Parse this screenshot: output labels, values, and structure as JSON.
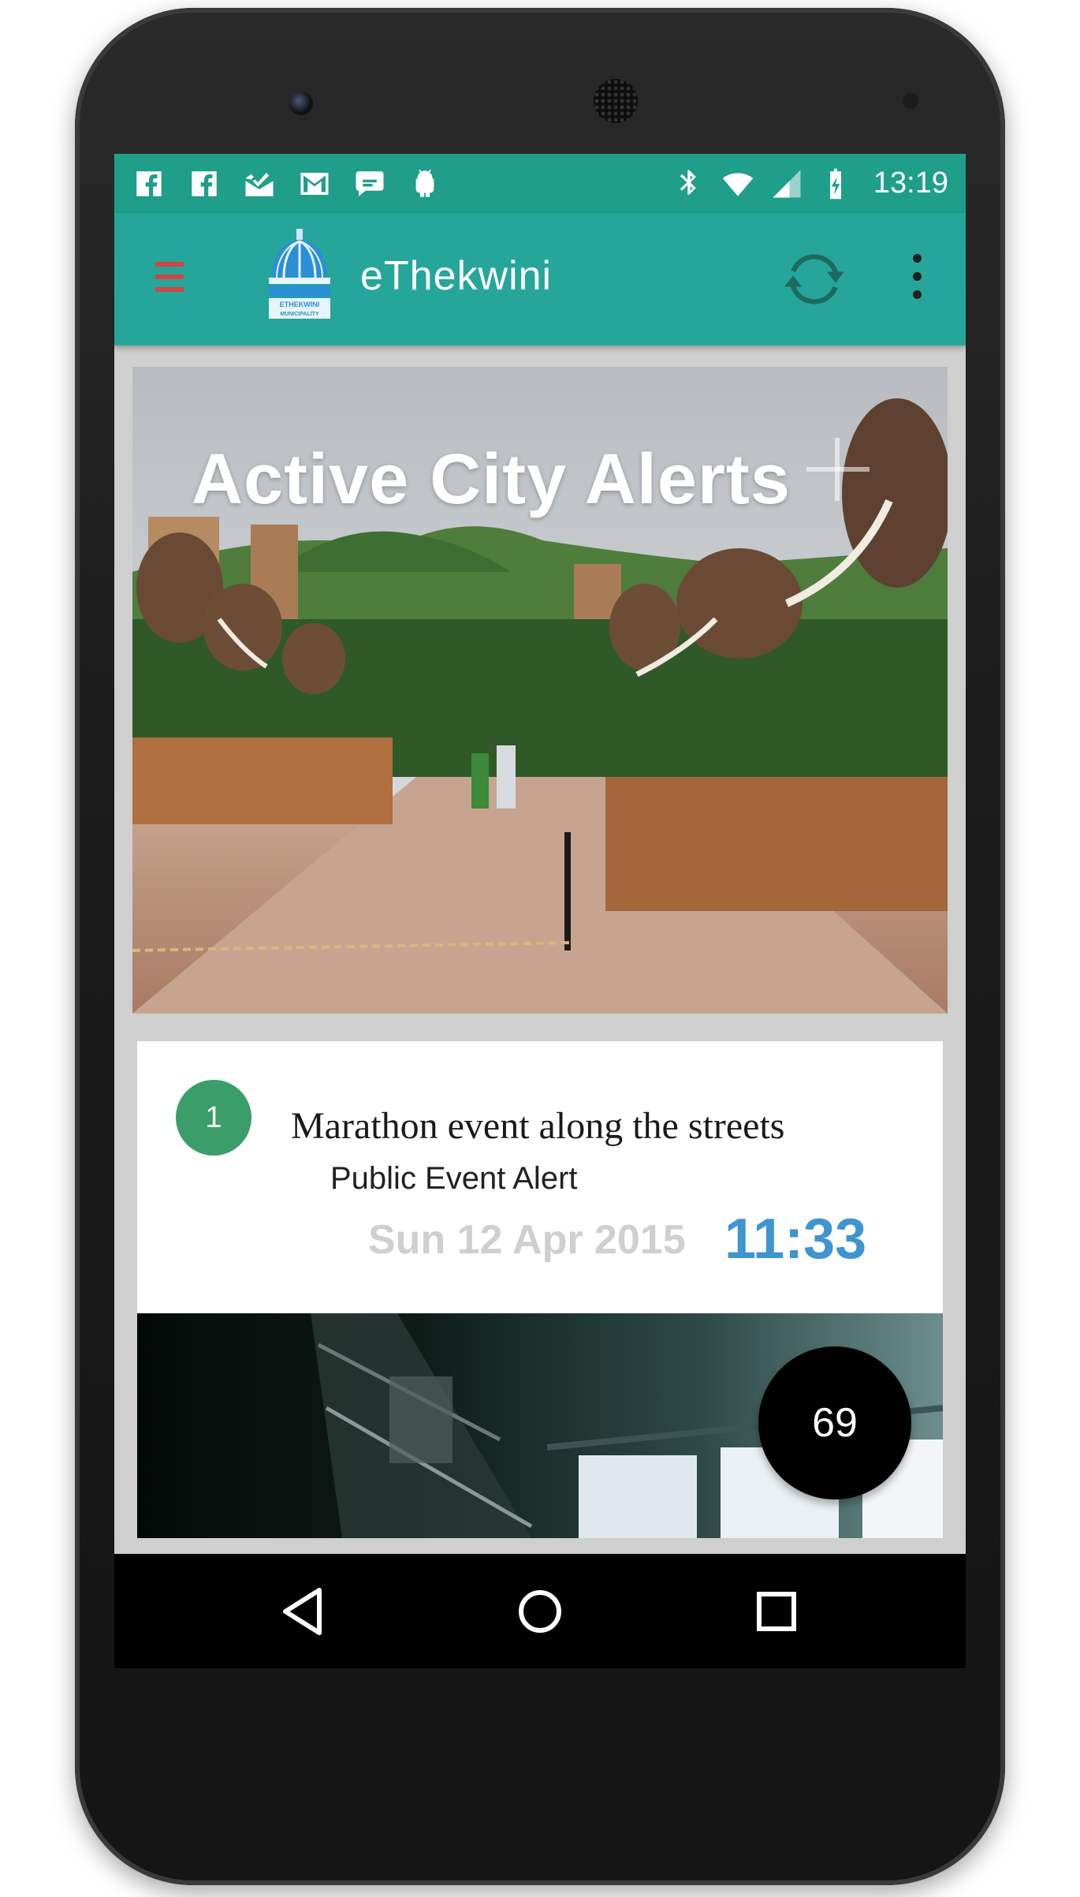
{
  "status_bar": {
    "notification_icons": [
      "facebook-icon",
      "facebook-icon",
      "mail-check-icon",
      "gmail-icon",
      "chat-bubble-icon",
      "android-icon"
    ],
    "system_icons": [
      "bluetooth-icon",
      "wifi-icon",
      "signal-icon",
      "battery-charging-icon"
    ],
    "time": "13:19"
  },
  "app_bar": {
    "menu_icon": "hamburger-icon",
    "logo_text": "ETHEKWINI MUNICIPALITY",
    "title": "eThekwini",
    "refresh_icon": "refresh-icon",
    "overflow_icon": "more-vert-icon"
  },
  "hero": {
    "title": "Active City Alerts",
    "add_icon": "plus-icon"
  },
  "alerts": [
    {
      "number": "1",
      "title": "Marathon event along the streets",
      "type": "Public Event Alert",
      "date": "Sun 12 Apr 2015",
      "time": "11:33"
    }
  ],
  "fab": {
    "count": "69"
  },
  "nav_bar": {
    "back_icon": "back-triangle-icon",
    "home_icon": "home-circle-icon",
    "recents_icon": "recents-square-icon"
  },
  "colors": {
    "status_bar": "#1f9e8a",
    "app_bar": "#26a69a",
    "alert_badge": "#3a9d6a",
    "time_accent": "#3f95cf",
    "date_text": "#cfcfcf"
  }
}
